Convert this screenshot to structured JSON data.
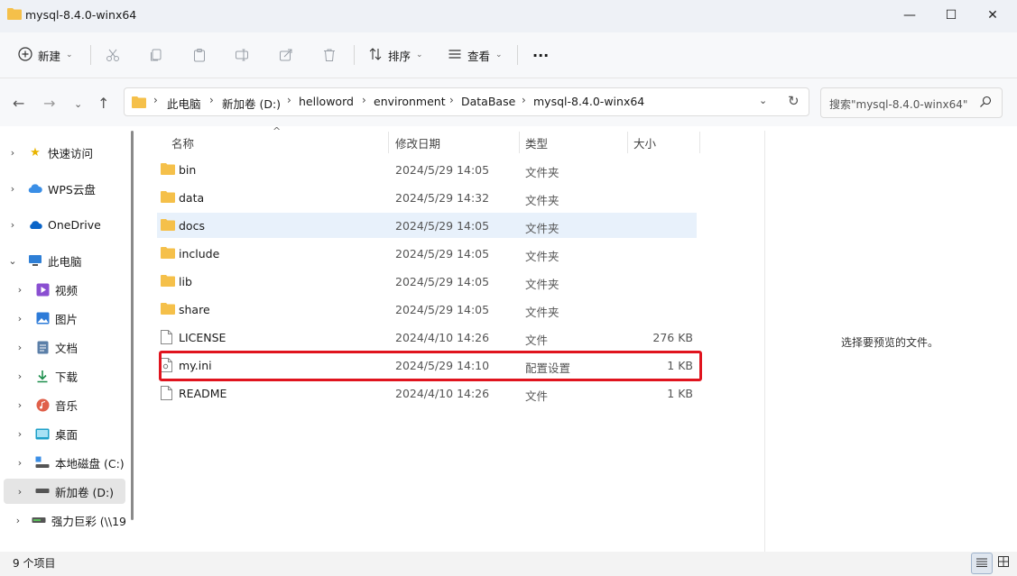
{
  "window": {
    "title": "mysql-8.4.0-winx64",
    "minimize_icon": "—",
    "maximize_icon": "☐",
    "close_icon": "✕"
  },
  "toolbar": {
    "new_label": "新建",
    "sort_label": "排序",
    "view_label": "查看",
    "more_label": "···"
  },
  "address": {
    "crumbs": [
      "此电脑",
      "新加卷 (D:)",
      "helloword",
      "environment",
      "DataBase",
      "mysql-8.4.0-winx64"
    ],
    "search_placeholder": "搜索\"mysql-8.4.0-winx64\""
  },
  "sidebar": {
    "items": [
      {
        "label": "快速访问",
        "icon": "star-icon"
      },
      {
        "label": "WPS云盘",
        "icon": "cloud-icon"
      },
      {
        "label": "OneDrive",
        "icon": "onedrive-icon"
      },
      {
        "label": "此电脑",
        "icon": "computer-icon"
      },
      {
        "label": "视频",
        "icon": "video-icon"
      },
      {
        "label": "图片",
        "icon": "image-icon"
      },
      {
        "label": "文档",
        "icon": "document-icon"
      },
      {
        "label": "下载",
        "icon": "download-icon"
      },
      {
        "label": "音乐",
        "icon": "music-icon"
      },
      {
        "label": "桌面",
        "icon": "desktop-icon"
      },
      {
        "label": "本地磁盘 (C:)",
        "icon": "drive-icon"
      },
      {
        "label": "新加卷 (D:)",
        "icon": "drive-icon"
      },
      {
        "label": "强力巨彩 (\\\\19",
        "icon": "network-drive-icon"
      }
    ]
  },
  "columns": {
    "name": "名称",
    "modified": "修改日期",
    "type": "类型",
    "size": "大小"
  },
  "files": [
    {
      "name": "bin",
      "modified": "2024/5/29 14:05",
      "type": "文件夹",
      "size": "",
      "kind": "folder"
    },
    {
      "name": "data",
      "modified": "2024/5/29 14:32",
      "type": "文件夹",
      "size": "",
      "kind": "folder"
    },
    {
      "name": "docs",
      "modified": "2024/5/29 14:05",
      "type": "文件夹",
      "size": "",
      "kind": "folder"
    },
    {
      "name": "include",
      "modified": "2024/5/29 14:05",
      "type": "文件夹",
      "size": "",
      "kind": "folder"
    },
    {
      "name": "lib",
      "modified": "2024/5/29 14:05",
      "type": "文件夹",
      "size": "",
      "kind": "folder"
    },
    {
      "name": "share",
      "modified": "2024/5/29 14:05",
      "type": "文件夹",
      "size": "",
      "kind": "folder"
    },
    {
      "name": "LICENSE",
      "modified": "2024/4/10 14:26",
      "type": "文件",
      "size": "276 KB",
      "kind": "file"
    },
    {
      "name": "my.ini",
      "modified": "2024/5/29 14:10",
      "type": "配置设置",
      "size": "1 KB",
      "kind": "config"
    },
    {
      "name": "README",
      "modified": "2024/4/10 14:26",
      "type": "文件",
      "size": "1 KB",
      "kind": "file"
    }
  ],
  "preview": {
    "empty_text": "选择要预览的文件。"
  },
  "status": {
    "item_count": "9 个项目"
  },
  "colors": {
    "folder": "#f5c04a",
    "highlight": "#e0141e",
    "hover_row": "#e8f1fb"
  }
}
